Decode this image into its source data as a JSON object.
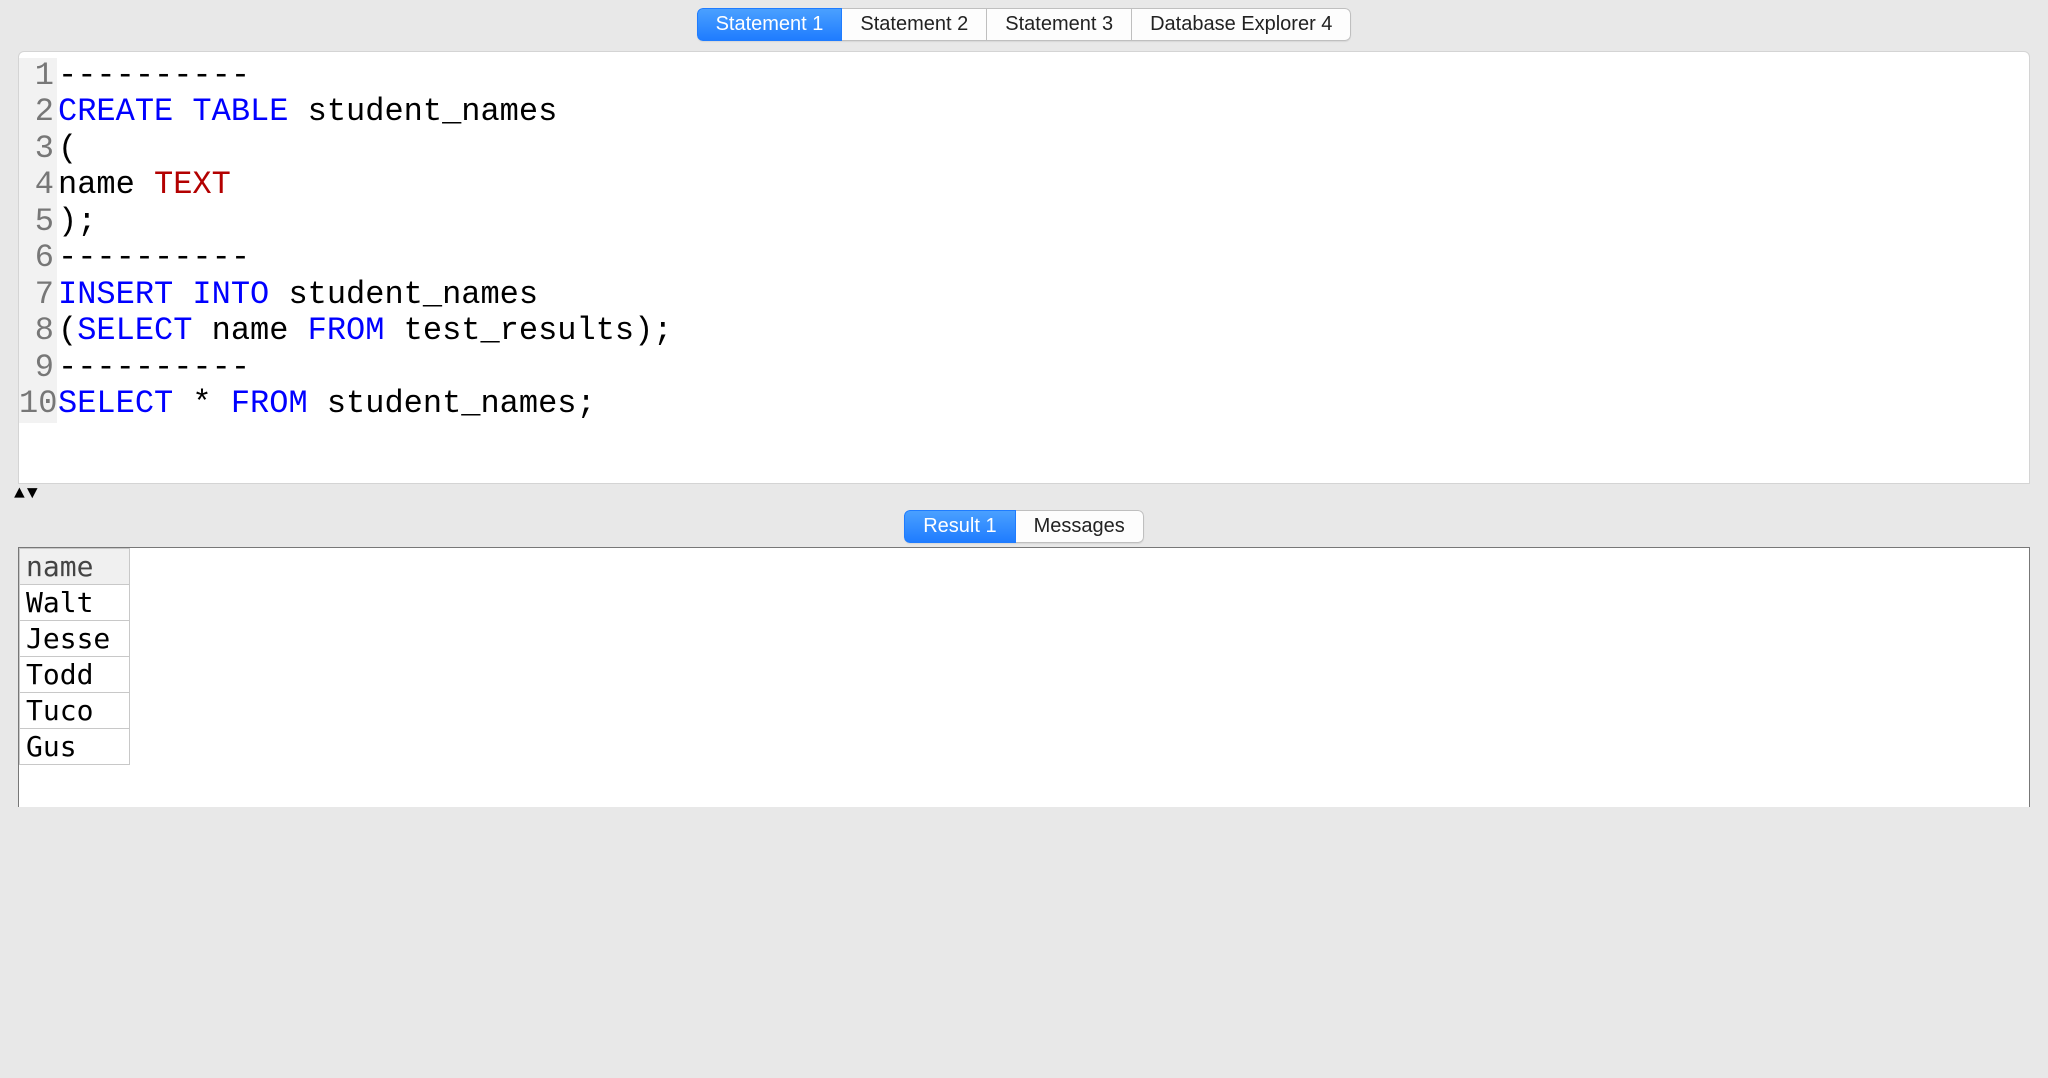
{
  "topTabs": {
    "items": [
      {
        "label": "Statement 1",
        "active": true
      },
      {
        "label": "Statement 2",
        "active": false
      },
      {
        "label": "Statement 3",
        "active": false
      },
      {
        "label": "Database Explorer 4",
        "active": false
      }
    ]
  },
  "editor": {
    "lines": [
      {
        "n": "1",
        "tokens": [
          {
            "t": "----------",
            "c": "cm"
          }
        ]
      },
      {
        "n": "2",
        "tokens": [
          {
            "t": "CREATE TABLE",
            "c": "kw"
          },
          {
            "t": " student_names"
          }
        ]
      },
      {
        "n": "3",
        "tokens": [
          {
            "t": "("
          }
        ]
      },
      {
        "n": "4",
        "tokens": [
          {
            "t": "name "
          },
          {
            "t": "TEXT",
            "c": "ty"
          }
        ]
      },
      {
        "n": "5",
        "tokens": [
          {
            "t": ");"
          }
        ]
      },
      {
        "n": "6",
        "tokens": [
          {
            "t": "----------",
            "c": "cm"
          }
        ]
      },
      {
        "n": "7",
        "tokens": [
          {
            "t": "INSERT INTO",
            "c": "kw"
          },
          {
            "t": " student_names"
          }
        ]
      },
      {
        "n": "8",
        "tokens": [
          {
            "t": "("
          },
          {
            "t": "SELECT",
            "c": "kw"
          },
          {
            "t": " name "
          },
          {
            "t": "FROM",
            "c": "kw"
          },
          {
            "t": " test_results);"
          }
        ]
      },
      {
        "n": "9",
        "tokens": [
          {
            "t": "----------",
            "c": "cm"
          }
        ]
      },
      {
        "n": "10",
        "tokens": [
          {
            "t": "SELECT",
            "c": "kw"
          },
          {
            "t": " * "
          },
          {
            "t": "FROM",
            "c": "kw"
          },
          {
            "t": " student_names;"
          }
        ]
      }
    ]
  },
  "splitter": {
    "upGlyph": "▲",
    "downGlyph": "▼"
  },
  "bottomTabs": {
    "items": [
      {
        "label": "Result 1",
        "active": true
      },
      {
        "label": "Messages",
        "active": false
      }
    ]
  },
  "result": {
    "columns": [
      "name"
    ],
    "rows": [
      [
        "Walt"
      ],
      [
        "Jesse"
      ],
      [
        "Todd"
      ],
      [
        "Tuco"
      ],
      [
        "Gus"
      ]
    ]
  }
}
